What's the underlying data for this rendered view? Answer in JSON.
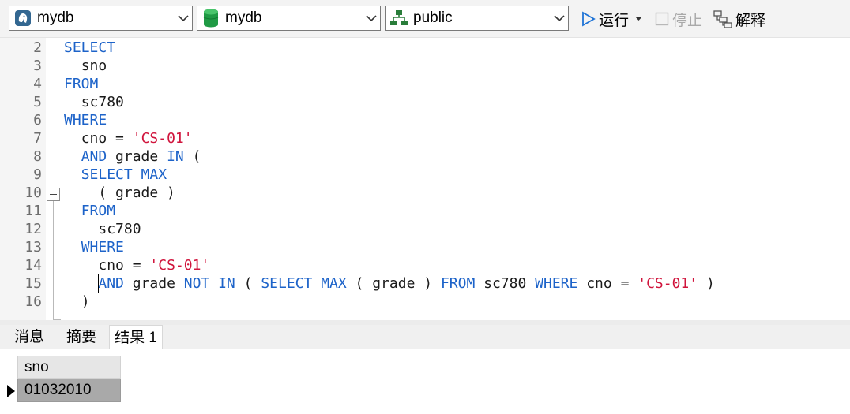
{
  "toolbar": {
    "connection": {
      "label": "mydb",
      "icon": "elephant-icon"
    },
    "database": {
      "label": "mydb",
      "icon": "database-icon"
    },
    "schema": {
      "label": "public",
      "icon": "schema-icon"
    },
    "run_label": "运行",
    "stop_label": "停止",
    "explain_label": "解释"
  },
  "editor": {
    "lines": [
      {
        "num": "2"
      },
      {
        "num": "3"
      },
      {
        "num": "4"
      },
      {
        "num": "5"
      },
      {
        "num": "6"
      },
      {
        "num": "7"
      },
      {
        "num": "8"
      },
      {
        "num": "9"
      },
      {
        "num": "10"
      },
      {
        "num": "11"
      },
      {
        "num": "12"
      },
      {
        "num": "13"
      },
      {
        "num": "14"
      },
      {
        "num": "15"
      },
      {
        "num": "16"
      }
    ],
    "tokens": {
      "select": "SELECT",
      "sno": "sno",
      "from": "FROM",
      "table": "sc780",
      "where": "WHERE",
      "cno": "cno",
      "eq": "=",
      "cs01": "'CS-01'",
      "and": "AND",
      "grade": "grade",
      "in": "IN",
      "lparen": "(",
      "rparen": ")",
      "select_max": "SELECT MAX",
      "grade_paren": "( grade )",
      "not_in": "NOT IN",
      "max": "MAX"
    }
  },
  "tabs": [
    "消息",
    "摘要",
    "结果 1"
  ],
  "results": {
    "columns": [
      "sno"
    ],
    "rows": [
      [
        "01032010"
      ]
    ]
  },
  "colors": {
    "keyword": "#1d63c9",
    "string": "#d0143c",
    "selected_row": "#a9a9a9"
  }
}
